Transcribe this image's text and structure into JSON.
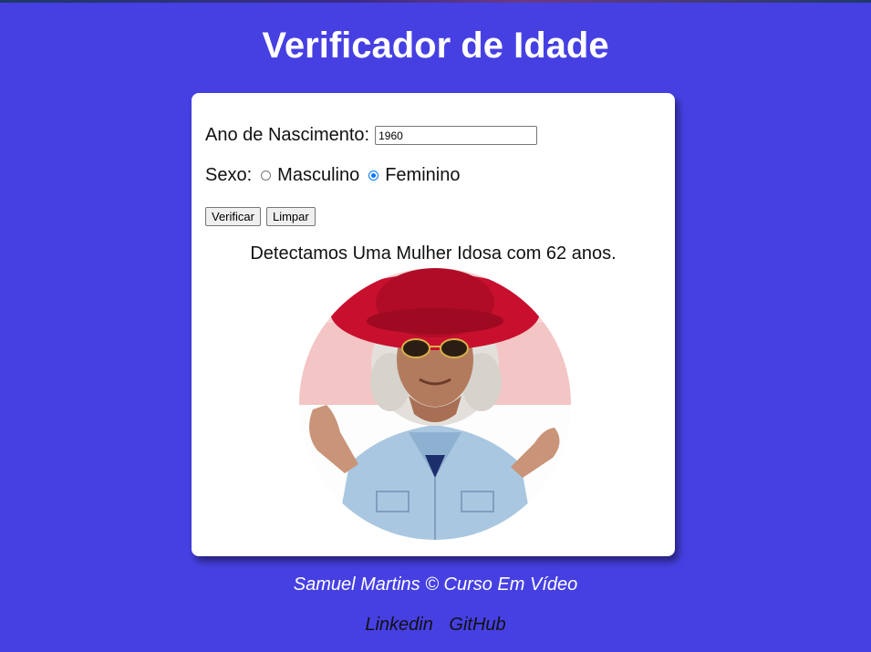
{
  "header": {
    "title": "Verificador de Idade"
  },
  "form": {
    "ano_label": "Ano de Nascimento:",
    "ano_value": "1960",
    "sexo_label": "Sexo:",
    "sexo_options": [
      {
        "label": "Masculino",
        "checked": false
      },
      {
        "label": "Feminino",
        "checked": true
      }
    ],
    "verificar_label": "Verificar",
    "limpar_label": "Limpar"
  },
  "result": {
    "text": "Detectamos Uma Mulher Idosa com 62 anos.",
    "image_subject": "elderly-woman-red-hat"
  },
  "footer": {
    "credit": "Samuel Martins © Curso Em Vídeo",
    "links": [
      "Linkedin",
      "GitHub"
    ]
  },
  "colors": {
    "background": "#4640e3",
    "card": "#ffffff",
    "radio_accent": "#0075ff"
  }
}
